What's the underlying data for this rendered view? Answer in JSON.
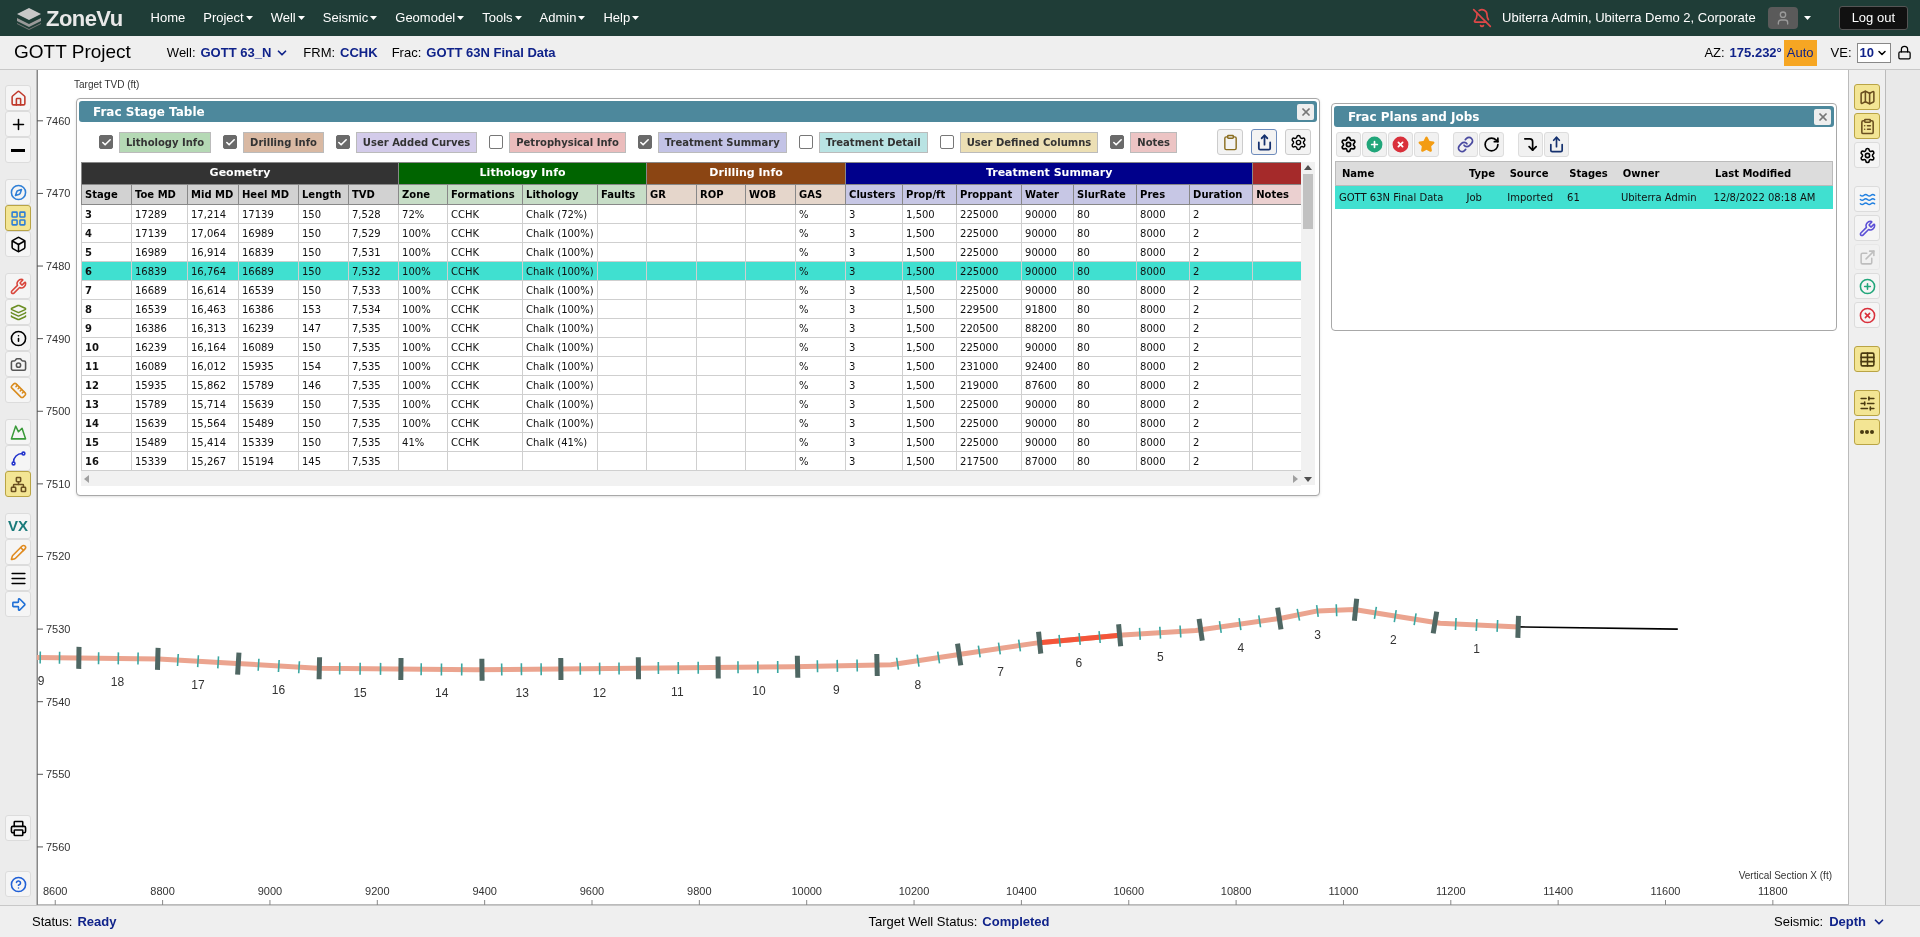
{
  "nav": {
    "logo": "ZoneVu",
    "menu": [
      {
        "label": "Home",
        "dropdown": false
      },
      {
        "label": "Project",
        "dropdown": true
      },
      {
        "label": "Well",
        "dropdown": true
      },
      {
        "label": "Seismic",
        "dropdown": true
      },
      {
        "label": "Geomodel",
        "dropdown": true
      },
      {
        "label": "Tools",
        "dropdown": true
      },
      {
        "label": "Admin",
        "dropdown": true
      },
      {
        "label": "Help",
        "dropdown": true
      }
    ],
    "user": "Ubiterra Admin, Ubiterra Demo 2, Corporate",
    "logout": "Log out"
  },
  "header": {
    "project": "GOTT Project",
    "fields": [
      {
        "label": "Well:",
        "value": "GOTT 63_N",
        "dropdown": true
      },
      {
        "label": "FRM:",
        "value": "CCHK",
        "dropdown": false
      },
      {
        "label": "Frac:",
        "value": "GOTT 63N Final Data",
        "dropdown": false
      }
    ],
    "az_label": "AZ:",
    "az_value": "175.232°",
    "auto": "Auto",
    "ve_label": "VE:",
    "ve_value": "10"
  },
  "left_toolbar": {
    "groups": [
      {
        "items": [
          {
            "selected": false
          },
          {
            "selected": false
          },
          {
            "selected": false
          }
        ]
      },
      {
        "items": [
          {
            "selected": false
          },
          {
            "selected": true
          },
          {
            "selected": false
          }
        ]
      },
      {
        "items": [
          {
            "selected": false
          },
          {
            "selected": false
          },
          {
            "selected": false
          },
          {
            "selected": false
          },
          {
            "selected": false
          }
        ]
      },
      {
        "items": [
          {
            "selected": false
          },
          {
            "selected": false
          },
          {
            "selected": true
          }
        ]
      },
      {
        "items": [
          {
            "label": "VX",
            "selected": false
          },
          {
            "selected": false
          },
          {
            "selected": false
          },
          {
            "selected": false
          }
        ]
      },
      {
        "items": [
          {
            "selected": false
          }
        ]
      },
      {
        "items": [
          {
            "selected": false
          }
        ]
      }
    ]
  },
  "right_toolbar": {
    "groups": [
      {
        "items": [
          {
            "selected": true,
            "disabled": false
          },
          {
            "selected": true,
            "disabled": false
          },
          {
            "selected": false,
            "disabled": false
          }
        ]
      },
      {
        "items": [
          {
            "selected": false,
            "disabled": false
          },
          {
            "selected": false,
            "disabled": false
          },
          {
            "selected": false,
            "disabled": true
          },
          {
            "selected": false,
            "disabled": false
          },
          {
            "selected": false,
            "disabled": false
          }
        ]
      },
      {
        "items": [
          {
            "selected": true,
            "disabled": false
          }
        ]
      },
      {
        "items": [
          {
            "selected": true,
            "disabled": false
          },
          {
            "selected": true,
            "disabled": false
          }
        ]
      }
    ]
  },
  "frac_stage_table": {
    "title": "Frac Stage Table",
    "filters": [
      {
        "label": "Lithology Info",
        "checked": true,
        "color": "#b5d9b5"
      },
      {
        "label": "Drilling Info",
        "checked": true,
        "color": "#d9b9a3"
      },
      {
        "label": "User Added Curves",
        "checked": true,
        "color": "#d3cbea"
      },
      {
        "label": "Petrophysical Info",
        "checked": false,
        "color": "#ebbcbc"
      },
      {
        "label": "Treatment Summary",
        "checked": true,
        "color": "#c3c3e6"
      },
      {
        "label": "Treatment Detail",
        "checked": false,
        "color": "#b9e3e3"
      },
      {
        "label": "User Defined Columns",
        "checked": false,
        "color": "#ecdfb4"
      },
      {
        "label": "Notes",
        "checked": true,
        "color": "#ecc4c4"
      }
    ],
    "groups": [
      {
        "label": "Geometry",
        "color": "#333333",
        "columns": [
          "Stage",
          "Toe MD",
          "Mid MD",
          "Heel MD",
          "Length",
          "TVD"
        ]
      },
      {
        "label": "Lithology Info",
        "color": "#006400",
        "columns": [
          "Zone",
          "Formations",
          "Lithology",
          "Faults"
        ]
      },
      {
        "label": "Drilling Info",
        "color": "#8b4513",
        "columns": [
          "GR",
          "ROP",
          "WOB",
          "GAS"
        ]
      },
      {
        "label": "Treatment Summary",
        "color": "#00008b",
        "columns": [
          "Clusters",
          "Prop/ft",
          "Proppant",
          "Water",
          "SlurRate",
          "Pres",
          "Duration"
        ]
      },
      {
        "color": "#a52a2a",
        "columns": [
          "Notes"
        ]
      }
    ],
    "rows": [
      {
        "selected": false,
        "cells": [
          "3",
          "17289",
          "17,214",
          "17139",
          "150",
          "7,528",
          "72%",
          "CCHK",
          "Chalk (72%)",
          null,
          null,
          null,
          null,
          "%",
          "3",
          "1,500",
          "225000",
          "90000",
          "80",
          "8000",
          "2",
          null
        ]
      },
      {
        "selected": false,
        "cells": [
          "4",
          "17139",
          "17,064",
          "16989",
          "150",
          "7,529",
          "100%",
          "CCHK",
          "Chalk (100%)",
          null,
          null,
          null,
          null,
          "%",
          "3",
          "1,500",
          "225000",
          "90000",
          "80",
          "8000",
          "2",
          null
        ]
      },
      {
        "selected": false,
        "cells": [
          "5",
          "16989",
          "16,914",
          "16839",
          "150",
          "7,531",
          "100%",
          "CCHK",
          "Chalk (100%)",
          null,
          null,
          null,
          null,
          "%",
          "3",
          "1,500",
          "225000",
          "90000",
          "80",
          "8000",
          "2",
          null
        ]
      },
      {
        "selected": true,
        "cells": [
          "6",
          "16839",
          "16,764",
          "16689",
          "150",
          "7,532",
          "100%",
          "CCHK",
          "Chalk (100%)",
          null,
          null,
          null,
          null,
          "%",
          "3",
          "1,500",
          "225000",
          "90000",
          "80",
          "8000",
          "2",
          null
        ]
      },
      {
        "selected": false,
        "cells": [
          "7",
          "16689",
          "16,614",
          "16539",
          "150",
          "7,533",
          "100%",
          "CCHK",
          "Chalk (100%)",
          null,
          null,
          null,
          null,
          "%",
          "3",
          "1,500",
          "225000",
          "90000",
          "80",
          "8000",
          "2",
          null
        ]
      },
      {
        "selected": false,
        "cells": [
          "8",
          "16539",
          "16,463",
          "16386",
          "153",
          "7,534",
          "100%",
          "CCHK",
          "Chalk (100%)",
          null,
          null,
          null,
          null,
          "%",
          "3",
          "1,500",
          "229500",
          "91800",
          "80",
          "8000",
          "2",
          null
        ]
      },
      {
        "selected": false,
        "cells": [
          "9",
          "16386",
          "16,313",
          "16239",
          "147",
          "7,535",
          "100%",
          "CCHK",
          "Chalk (100%)",
          null,
          null,
          null,
          null,
          "%",
          "3",
          "1,500",
          "220500",
          "88200",
          "80",
          "8000",
          "2",
          null
        ]
      },
      {
        "selected": false,
        "cells": [
          "10",
          "16239",
          "16,164",
          "16089",
          "150",
          "7,535",
          "100%",
          "CCHK",
          "Chalk (100%)",
          null,
          null,
          null,
          null,
          "%",
          "3",
          "1,500",
          "225000",
          "90000",
          "80",
          "8000",
          "2",
          null
        ]
      },
      {
        "selected": false,
        "cells": [
          "11",
          "16089",
          "16,012",
          "15935",
          "154",
          "7,535",
          "100%",
          "CCHK",
          "Chalk (100%)",
          null,
          null,
          null,
          null,
          "%",
          "3",
          "1,500",
          "231000",
          "92400",
          "80",
          "8000",
          "2",
          null
        ]
      },
      {
        "selected": false,
        "cells": [
          "12",
          "15935",
          "15,862",
          "15789",
          "146",
          "7,535",
          "100%",
          "CCHK",
          "Chalk (100%)",
          null,
          null,
          null,
          null,
          "%",
          "3",
          "1,500",
          "219000",
          "87600",
          "80",
          "8000",
          "2",
          null
        ]
      },
      {
        "selected": false,
        "cells": [
          "13",
          "15789",
          "15,714",
          "15639",
          "150",
          "7,535",
          "100%",
          "CCHK",
          "Chalk (100%)",
          null,
          null,
          null,
          null,
          "%",
          "3",
          "1,500",
          "225000",
          "90000",
          "80",
          "8000",
          "2",
          null
        ]
      },
      {
        "selected": false,
        "cells": [
          "14",
          "15639",
          "15,564",
          "15489",
          "150",
          "7,535",
          "100%",
          "CCHK",
          "Chalk (100%)",
          null,
          null,
          null,
          null,
          "%",
          "3",
          "1,500",
          "225000",
          "90000",
          "80",
          "8000",
          "2",
          null
        ]
      },
      {
        "selected": false,
        "cells": [
          "15",
          "15489",
          "15,414",
          "15339",
          "150",
          "7,535",
          "41%",
          "CCHK",
          "Chalk (41%)",
          null,
          null,
          null,
          null,
          "%",
          "3",
          "1,500",
          "225000",
          "90000",
          "80",
          "8000",
          "2",
          null
        ]
      },
      {
        "selected": false,
        "cells": [
          "16",
          "15339",
          "15,267",
          "15194",
          "145",
          "7,535",
          null,
          null,
          null,
          null,
          null,
          null,
          null,
          "%",
          "3",
          "1,500",
          "217500",
          "87000",
          "80",
          "8000",
          "2",
          null
        ]
      }
    ]
  },
  "frac_plans": {
    "title": "Frac Plans and Jobs",
    "columns": [
      "Name",
      "Type",
      "Source",
      "Stages",
      "Owner",
      "Last Modified"
    ],
    "rows": [
      {
        "selected": true,
        "cells": [
          "GOTT 63N Final Data",
          "Job",
          "Imported",
          "61",
          "Ubiterra Admin",
          "12/8/2022 08:18 AM"
        ]
      }
    ]
  },
  "chart": {
    "stages": [
      {
        "label": "9",
        "selected": false
      },
      {
        "label": "18",
        "selected": false
      },
      {
        "label": "17",
        "selected": false
      },
      {
        "label": "16",
        "selected": false
      },
      {
        "label": "15",
        "selected": false
      },
      {
        "label": "14",
        "selected": false
      },
      {
        "label": "13",
        "selected": false
      },
      {
        "label": "12",
        "selected": false
      },
      {
        "label": "11",
        "selected": false
      },
      {
        "label": "10",
        "selected": false
      },
      {
        "label": "9",
        "selected": false
      },
      {
        "label": "8",
        "selected": false
      },
      {
        "label": "7",
        "selected": false
      },
      {
        "label": "6",
        "selected": true
      },
      {
        "label": "5",
        "selected": false
      },
      {
        "label": "4",
        "selected": false
      },
      {
        "label": "3",
        "selected": false
      },
      {
        "label": "2",
        "selected": false
      },
      {
        "label": "1",
        "selected": false
      }
    ],
    "chart_data": {
      "type": "line",
      "xlabel": "Vertical Section X (ft)",
      "ylabel": "Target TVD (ft)",
      "xlim": [
        8566,
        11940
      ],
      "ylim": [
        7568,
        7453
      ],
      "xticks": [
        8600,
        8800,
        9000,
        9200,
        9400,
        9600,
        9800,
        10000,
        10200,
        10400,
        10600,
        10800,
        11000,
        11200,
        11400,
        11600,
        11800
      ],
      "yticks": [
        7460,
        7470,
        7480,
        7490,
        7500,
        7510,
        7520,
        7530,
        7540,
        7550,
        7560
      ],
      "x": [
        8566,
        8793,
        8930,
        9089,
        9384,
        9680,
        9975,
        10157,
        10293,
        10430,
        10589,
        10725,
        10884,
        10952,
        11020,
        11180,
        11327,
        11623
      ],
      "series": [
        {
          "color": "#eba48f",
          "values": [
            7533.9,
            7534.1,
            7534.7,
            7535.4,
            7535.6,
            7535.4,
            7535.2,
            7534.9,
            7533.4,
            7531.9,
            7530.8,
            7530.2,
            7528.5,
            7527.5,
            7527.3,
            7529.2,
            7529.7,
            null
          ]
        },
        {
          "color": "#000000",
          "values": [
            null,
            null,
            null,
            null,
            null,
            null,
            null,
            null,
            null,
            null,
            null,
            null,
            null,
            null,
            null,
            null,
            7529.7,
            7530.0
          ]
        }
      ]
    }
  },
  "status_bar": {
    "status_label": "Status:",
    "status": "Ready",
    "target_label": "Target Well Status:",
    "target": "Completed",
    "seismic_label": "Seismic:",
    "seismic": "Depth"
  }
}
